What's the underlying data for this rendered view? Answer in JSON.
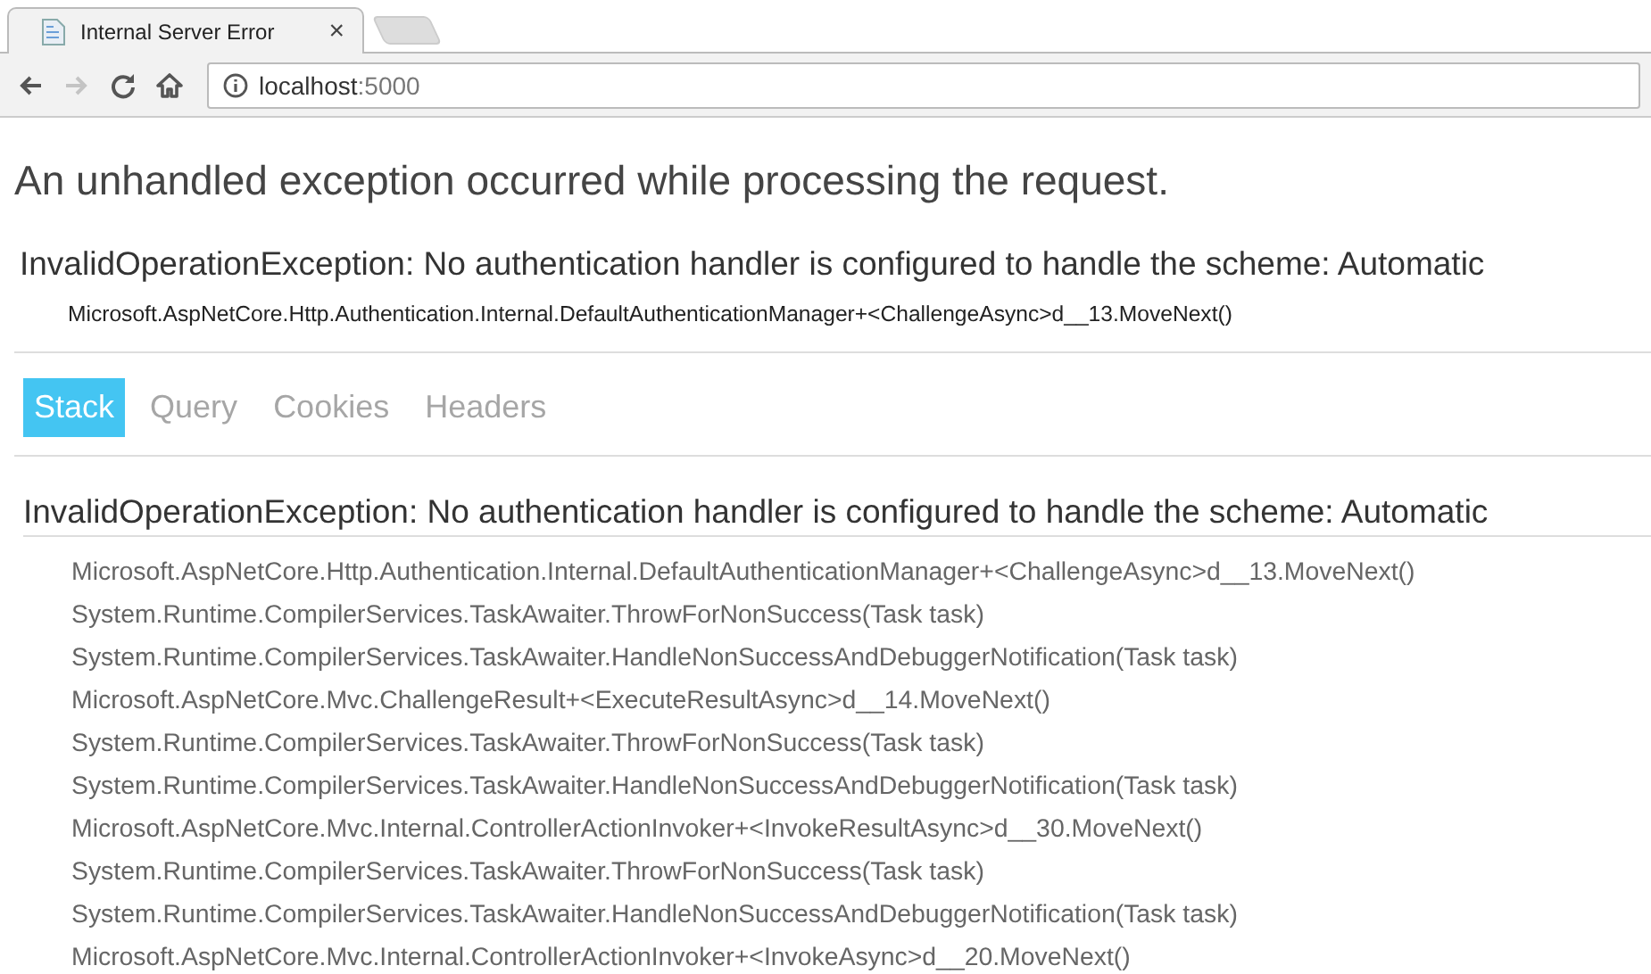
{
  "browser": {
    "tab": {
      "title": "Internal Server Error",
      "close": "×"
    },
    "nav": [
      {
        "kind": "back",
        "disabled": false
      },
      {
        "kind": "forward",
        "disabled": true
      },
      {
        "kind": "reload",
        "disabled": false
      },
      {
        "kind": "home",
        "disabled": false
      }
    ],
    "address": {
      "host": "localhost",
      "port": ":5000"
    }
  },
  "page": {
    "title": "An unhandled exception occurred while processing the request.",
    "exception": "InvalidOperationException: No authentication handler is configured to handle the scheme: Automatic",
    "location": "Microsoft.AspNetCore.Http.Authentication.Internal.DefaultAuthenticationManager+<ChallengeAsync>d__13.MoveNext()",
    "tabs": [
      {
        "label": "Stack",
        "selected": true
      },
      {
        "label": "Query",
        "selected": false
      },
      {
        "label": "Cookies",
        "selected": false
      },
      {
        "label": "Headers",
        "selected": false
      }
    ],
    "stack": {
      "exception": "InvalidOperationException: No authentication handler is configured to handle the scheme: Automatic",
      "frames": [
        "Microsoft.AspNetCore.Http.Authentication.Internal.DefaultAuthenticationManager+<ChallengeAsync>d__13.MoveNext()",
        "System.Runtime.CompilerServices.TaskAwaiter.ThrowForNonSuccess(Task task)",
        "System.Runtime.CompilerServices.TaskAwaiter.HandleNonSuccessAndDebuggerNotification(Task task)",
        "Microsoft.AspNetCore.Mvc.ChallengeResult+<ExecuteResultAsync>d__14.MoveNext()",
        "System.Runtime.CompilerServices.TaskAwaiter.ThrowForNonSuccess(Task task)",
        "System.Runtime.CompilerServices.TaskAwaiter.HandleNonSuccessAndDebuggerNotification(Task task)",
        "Microsoft.AspNetCore.Mvc.Internal.ControllerActionInvoker+<InvokeResultAsync>d__30.MoveNext()",
        "System.Runtime.CompilerServices.TaskAwaiter.ThrowForNonSuccess(Task task)",
        "System.Runtime.CompilerServices.TaskAwaiter.HandleNonSuccessAndDebuggerNotification(Task task)",
        "Microsoft.AspNetCore.Mvc.Internal.ControllerActionInvoker+<InvokeAsync>d__20.MoveNext()"
      ]
    }
  }
}
